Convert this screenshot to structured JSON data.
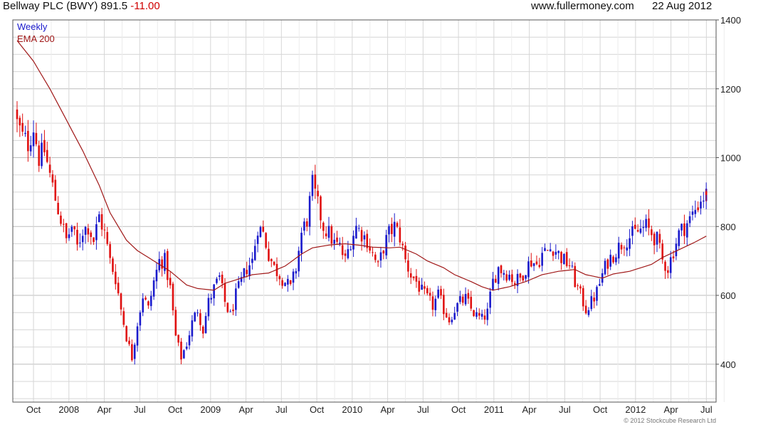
{
  "header": {
    "title": "Bellway PLC (BWY) 891.5",
    "change": "-11.00",
    "site": "www.fullermoney.com",
    "date": "22 Aug 2012"
  },
  "legend": {
    "period": "Weekly",
    "ema": "EMA 200",
    "period_color": "#1a1acc",
    "ema_color": "#a01818"
  },
  "copyright": "© 2012 Stockcube Research Ltd",
  "chart_data": {
    "type": "candlestick",
    "y_ticks": [
      400,
      600,
      800,
      1000,
      1200,
      1400
    ],
    "ylim": [
      290,
      1400
    ],
    "x_ticks": [
      "Oct",
      "2008",
      "Apr",
      "Jul",
      "Oct",
      "2009",
      "Apr",
      "Jul",
      "Oct",
      "2010",
      "Apr",
      "Jul",
      "Oct",
      "2011",
      "Apr",
      "Jul",
      "Oct",
      "2012",
      "Apr",
      "Jul"
    ],
    "colors": {
      "up": "#1a1acc",
      "down": "#e01010",
      "ema": "#a01818",
      "grid": "#d6d6d6"
    },
    "close_series": [
      [
        0,
        1100
      ],
      [
        2,
        1060
      ],
      [
        4,
        1040
      ],
      [
        6,
        1090
      ],
      [
        8,
        1000
      ],
      [
        10,
        1020
      ],
      [
        12,
        950
      ],
      [
        14,
        880
      ],
      [
        16,
        820
      ],
      [
        18,
        760
      ],
      [
        20,
        800
      ],
      [
        22,
        740
      ],
      [
        24,
        790
      ],
      [
        26,
        800
      ],
      [
        28,
        760
      ],
      [
        30,
        830
      ],
      [
        32,
        780
      ],
      [
        34,
        700
      ],
      [
        36,
        650
      ],
      [
        38,
        560
      ],
      [
        40,
        480
      ],
      [
        42,
        420
      ],
      [
        44,
        520
      ],
      [
        46,
        600
      ],
      [
        48,
        560
      ],
      [
        50,
        640
      ],
      [
        52,
        700
      ],
      [
        54,
        700
      ],
      [
        56,
        620
      ],
      [
        58,
        480
      ],
      [
        60,
        420
      ],
      [
        62,
        460
      ],
      [
        64,
        520
      ],
      [
        66,
        560
      ],
      [
        68,
        500
      ],
      [
        70,
        580
      ],
      [
        72,
        620
      ],
      [
        74,
        650
      ],
      [
        76,
        580
      ],
      [
        78,
        540
      ],
      [
        80,
        600
      ],
      [
        82,
        640
      ],
      [
        84,
        680
      ],
      [
        86,
        700
      ],
      [
        88,
        800
      ],
      [
        90,
        780
      ],
      [
        92,
        720
      ],
      [
        94,
        680
      ],
      [
        96,
        660
      ],
      [
        98,
        640
      ],
      [
        100,
        620
      ],
      [
        102,
        680
      ],
      [
        104,
        780
      ],
      [
        106,
        820
      ],
      [
        108,
        920
      ],
      [
        110,
        860
      ],
      [
        112,
        800
      ],
      [
        114,
        780
      ],
      [
        116,
        750
      ],
      [
        118,
        740
      ],
      [
        120,
        700
      ],
      [
        122,
        760
      ],
      [
        124,
        800
      ],
      [
        126,
        780
      ],
      [
        128,
        760
      ],
      [
        130,
        720
      ],
      [
        132,
        680
      ],
      [
        134,
        740
      ],
      [
        136,
        780
      ],
      [
        138,
        800
      ],
      [
        140,
        770
      ],
      [
        142,
        700
      ],
      [
        144,
        660
      ],
      [
        146,
        640
      ],
      [
        148,
        610
      ],
      [
        150,
        590
      ],
      [
        152,
        570
      ],
      [
        154,
        600
      ],
      [
        156,
        560
      ],
      [
        158,
        530
      ],
      [
        160,
        560
      ],
      [
        162,
        580
      ],
      [
        164,
        590
      ],
      [
        166,
        560
      ],
      [
        168,
        540
      ],
      [
        170,
        530
      ],
      [
        172,
        550
      ],
      [
        174,
        640
      ],
      [
        176,
        680
      ],
      [
        178,
        670
      ],
      [
        180,
        660
      ],
      [
        182,
        640
      ],
      [
        184,
        650
      ],
      [
        186,
        680
      ],
      [
        188,
        700
      ],
      [
        190,
        690
      ],
      [
        192,
        720
      ],
      [
        194,
        730
      ],
      [
        196,
        740
      ],
      [
        198,
        720
      ],
      [
        200,
        700
      ],
      [
        202,
        690
      ],
      [
        204,
        640
      ],
      [
        206,
        600
      ],
      [
        208,
        560
      ],
      [
        210,
        580
      ],
      [
        212,
        610
      ],
      [
        214,
        660
      ],
      [
        216,
        700
      ],
      [
        218,
        720
      ],
      [
        220,
        740
      ],
      [
        222,
        760
      ],
      [
        224,
        770
      ],
      [
        226,
        780
      ],
      [
        228,
        790
      ],
      [
        230,
        800
      ],
      [
        232,
        780
      ],
      [
        234,
        760
      ],
      [
        236,
        700
      ],
      [
        238,
        680
      ],
      [
        240,
        730
      ],
      [
        242,
        780
      ],
      [
        244,
        800
      ],
      [
        246,
        820
      ],
      [
        248,
        850
      ],
      [
        250,
        880
      ],
      [
        252,
        891.5
      ]
    ],
    "ema_series": [
      [
        0,
        1340
      ],
      [
        6,
        1280
      ],
      [
        12,
        1200
      ],
      [
        18,
        1110
      ],
      [
        24,
        1020
      ],
      [
        30,
        920
      ],
      [
        34,
        840
      ],
      [
        40,
        760
      ],
      [
        44,
        730
      ],
      [
        50,
        700
      ],
      [
        56,
        670
      ],
      [
        62,
        630
      ],
      [
        66,
        620
      ],
      [
        72,
        615
      ],
      [
        76,
        635
      ],
      [
        82,
        650
      ],
      [
        86,
        660
      ],
      [
        92,
        665
      ],
      [
        98,
        685
      ],
      [
        104,
        720
      ],
      [
        108,
        738
      ],
      [
        114,
        746
      ],
      [
        120,
        750
      ],
      [
        126,
        745
      ],
      [
        130,
        740
      ],
      [
        136,
        738
      ],
      [
        140,
        740
      ],
      [
        146,
        720
      ],
      [
        150,
        700
      ],
      [
        156,
        680
      ],
      [
        160,
        660
      ],
      [
        166,
        640
      ],
      [
        170,
        625
      ],
      [
        174,
        615
      ],
      [
        180,
        625
      ],
      [
        186,
        640
      ],
      [
        192,
        660
      ],
      [
        198,
        670
      ],
      [
        204,
        675
      ],
      [
        208,
        660
      ],
      [
        214,
        650
      ],
      [
        218,
        662
      ],
      [
        224,
        670
      ],
      [
        228,
        680
      ],
      [
        232,
        690
      ],
      [
        236,
        710
      ],
      [
        240,
        725
      ],
      [
        244,
        740
      ],
      [
        248,
        755
      ],
      [
        252,
        772
      ]
    ]
  }
}
